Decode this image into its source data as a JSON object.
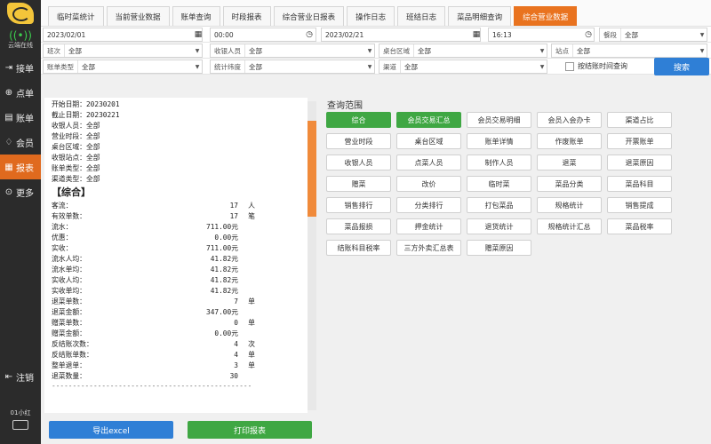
{
  "sidebar": {
    "online": "云端在线",
    "items": [
      {
        "label": "接单",
        "icon": "receive-icon"
      },
      {
        "label": "点单",
        "icon": "plus-circle-icon"
      },
      {
        "label": "账单",
        "icon": "bill-icon"
      },
      {
        "label": "会员",
        "icon": "member-icon"
      },
      {
        "label": "报表",
        "icon": "report-icon",
        "active": true
      },
      {
        "label": "更多",
        "icon": "more-icon"
      }
    ],
    "logout": "注销",
    "user": "01小红"
  },
  "tabs": [
    "临时菜统计",
    "当前营业数据",
    "账单查询",
    "时段报表",
    "综合营业日报表",
    "操作日志",
    "班结日志",
    "菜品明细查询",
    "综合营业数据"
  ],
  "filters": {
    "start_date": "2023/02/01",
    "start_time": "00:00",
    "end_date": "2023/02/21",
    "end_time": "16:13",
    "meal_label": "餐段",
    "meal_value": "全部",
    "shift_label": "班次",
    "shift_value": "全部",
    "cashier_label": "收银人员",
    "cashier_value": "全部",
    "table_area_label": "桌台区域",
    "table_area_value": "全部",
    "station_label": "站点",
    "station_value": "全部",
    "bill_type_label": "账单类型",
    "bill_type_value": "全部",
    "dimension_label": "统计纬度",
    "dimension_value": "全部",
    "channel_label": "渠道",
    "channel_value": "全部",
    "checkout_time_query": "按结账时间查询",
    "search": "搜索"
  },
  "report": {
    "header_lines": [
      "开始日期：20230201",
      "截止日期：20230221",
      "收银人员：全部",
      "营业时段：全部",
      "桌台区域：全部",
      "收银站点：全部",
      "账单类型：全部",
      "渠道类型：全部"
    ],
    "section": "【综合】",
    "stats": [
      {
        "k": "客流：",
        "v": "17",
        "u": "人"
      },
      {
        "k": "有效单数：",
        "v": "17",
        "u": "笔"
      },
      {
        "k": "流水：",
        "v": "711.00元",
        "u": ""
      },
      {
        "k": "优惠：",
        "v": "0.00元",
        "u": ""
      },
      {
        "k": "实收：",
        "v": "711.00元",
        "u": ""
      },
      {
        "k": "流水人均：",
        "v": "41.82元",
        "u": ""
      },
      {
        "k": "流水单均：",
        "v": "41.82元",
        "u": ""
      },
      {
        "k": "实收人均：",
        "v": "41.82元",
        "u": ""
      },
      {
        "k": "实收单均：",
        "v": "41.82元",
        "u": ""
      },
      {
        "k": "退菜单数：",
        "v": "7",
        "u": "单"
      },
      {
        "k": "退菜金额：",
        "v": "347.00元",
        "u": ""
      },
      {
        "k": "赠菜单数：",
        "v": "0",
        "u": "单"
      },
      {
        "k": "赠菜金额：",
        "v": "0.00元",
        "u": ""
      },
      {
        "k": "反结账次数：",
        "v": "4",
        "u": "次"
      },
      {
        "k": "反结账单数：",
        "v": "4",
        "u": "单"
      },
      {
        "k": "整单退单：",
        "v": "3",
        "u": "单"
      },
      {
        "k": "退菜数量：",
        "v": "30",
        "u": ""
      }
    ],
    "divider": "------------------------------------------------"
  },
  "buttons": {
    "export": "导出excel",
    "print": "打印报表"
  },
  "query_range": {
    "title": "查询范围",
    "items": [
      {
        "label": "综合",
        "active": true
      },
      {
        "label": "会员交易汇总",
        "active": true
      },
      {
        "label": "会员交易明细"
      },
      {
        "label": "会员入会办卡"
      },
      {
        "label": "渠道占比"
      },
      {
        "label": "营业时段"
      },
      {
        "label": "桌台区域"
      },
      {
        "label": "账单详情"
      },
      {
        "label": "作废账单"
      },
      {
        "label": "开票账单"
      },
      {
        "label": "收银人员"
      },
      {
        "label": "点菜人员"
      },
      {
        "label": "制作人员"
      },
      {
        "label": "退菜"
      },
      {
        "label": "退菜原因"
      },
      {
        "label": "赠菜"
      },
      {
        "label": "改价"
      },
      {
        "label": "临时菜"
      },
      {
        "label": "菜品分类"
      },
      {
        "label": "菜品科目"
      },
      {
        "label": "销售排行"
      },
      {
        "label": "分类排行"
      },
      {
        "label": "打包菜品"
      },
      {
        "label": "规格统计"
      },
      {
        "label": "销售提成"
      },
      {
        "label": "菜品报损"
      },
      {
        "label": "押金统计"
      },
      {
        "label": "退货统计"
      },
      {
        "label": "规格统计汇总"
      },
      {
        "label": "菜品税率"
      },
      {
        "label": "结账科目税率"
      },
      {
        "label": "三方外卖汇总表"
      },
      {
        "label": "赠菜原因"
      }
    ]
  },
  "colors": {
    "accent": "#e9731f",
    "primary": "#2f7fd6",
    "success": "#3fa743",
    "sidebar": "#2b2b2b"
  }
}
